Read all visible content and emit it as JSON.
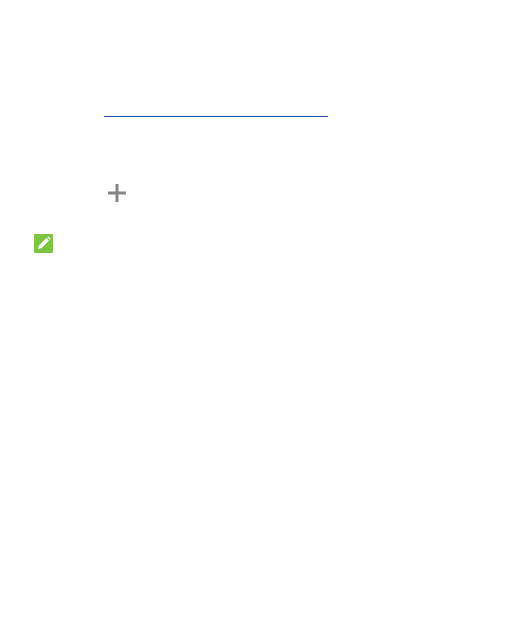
{
  "icons": {
    "plus": "plus-icon",
    "note": "note-pencil-icon"
  },
  "colors": {
    "link": "#1a4fb3",
    "plus_icon": "#858585",
    "note_background": "#7cc442"
  }
}
